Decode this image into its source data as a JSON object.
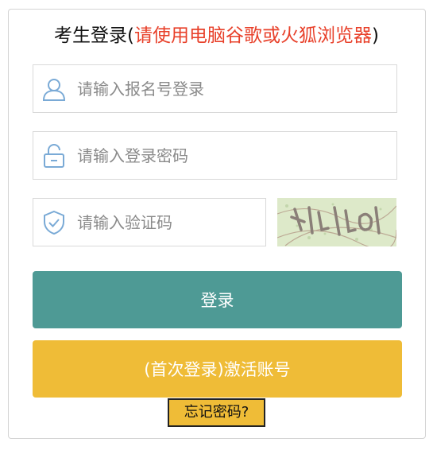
{
  "header": {
    "title": "考生登录",
    "note": "请使用电脑谷歌或火狐浏览器"
  },
  "form": {
    "username_placeholder": "请输入报名号登录",
    "password_placeholder": "请输入登录密码",
    "captcha_placeholder": "请输入验证码",
    "captcha_icon": "shield-check-icon",
    "user_icon": "user-icon",
    "lock_icon": "lock-icon"
  },
  "buttons": {
    "login": "登录",
    "activate": "(首次登录)激活账号",
    "forgot": "忘记密码?"
  },
  "colors": {
    "login": "#4e9a95",
    "activate": "#efbc37",
    "note": "#e8402a",
    "icon": "#7aaad6"
  }
}
